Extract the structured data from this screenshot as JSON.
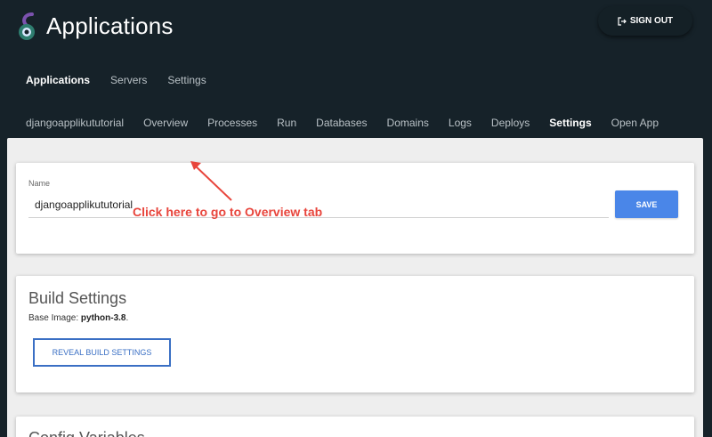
{
  "header": {
    "title": "Applications",
    "signout_label": "SIGN OUT",
    "brand_colors": {
      "ring_dark": "#2e7d6f",
      "ring_light": "#d9e9ff",
      "accent": "#7b52ae"
    }
  },
  "topnav": [
    {
      "label": "Applications",
      "active": true
    },
    {
      "label": "Servers",
      "active": false
    },
    {
      "label": "Settings",
      "active": false
    }
  ],
  "subnav": [
    {
      "label": "djangoapplikututorial",
      "active": false
    },
    {
      "label": "Overview",
      "active": false
    },
    {
      "label": "Processes",
      "active": false
    },
    {
      "label": "Run",
      "active": false
    },
    {
      "label": "Databases",
      "active": false
    },
    {
      "label": "Domains",
      "active": false
    },
    {
      "label": "Logs",
      "active": false
    },
    {
      "label": "Deploys",
      "active": false
    },
    {
      "label": "Settings",
      "active": true
    },
    {
      "label": "Open App",
      "active": false
    }
  ],
  "name_card": {
    "label": "Name",
    "value": "djangoapplikututorial",
    "save_label": "SAVE",
    "callout": "Click here to go to Overview tab"
  },
  "build_card": {
    "title": "Build Settings",
    "base_image_prefix": "Base Image: ",
    "base_image_value": "python-3.8",
    "base_image_suffix": ".",
    "reveal_label": "REVEAL BUILD SETTINGS"
  },
  "config_card": {
    "title": "Config Variables"
  },
  "colors": {
    "background": "#162229",
    "primary": "#4a86e8",
    "callout": "#e8453c"
  }
}
